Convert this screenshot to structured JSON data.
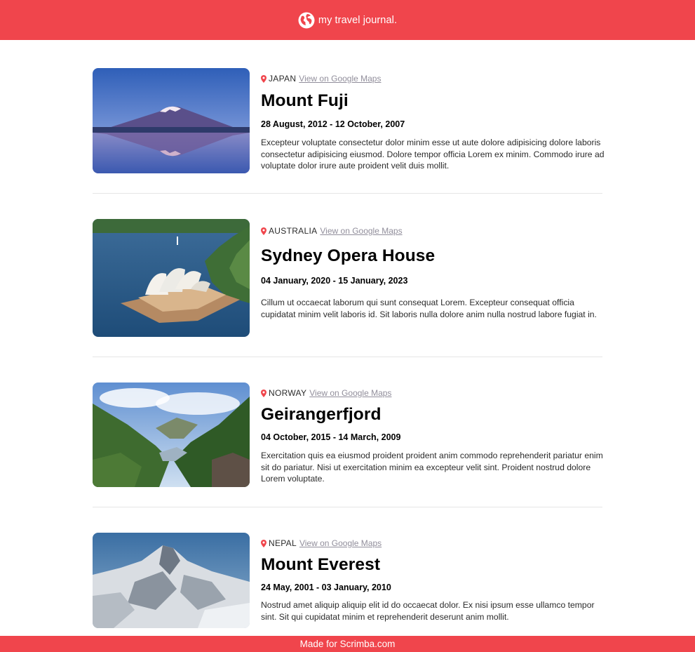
{
  "header": {
    "icon": "globe-icon",
    "title": "my travel journal."
  },
  "entries": [
    {
      "country": "Japan",
      "maps_label": "View on Google Maps",
      "title": "Mount Fuji",
      "dates": "28 August, 2012 - 12 October, 2007",
      "description": "Excepteur voluptate consectetur dolor minim esse ut aute dolore adipisicing dolore laboris consectetur adipisicing eiusmod. Dolore tempor officia Lorem ex minim. Commodo irure ad voluptate dolor irure aute proident velit duis mollit.",
      "image": "mount-fuji-photo"
    },
    {
      "country": "Australia",
      "maps_label": "View on Google Maps",
      "title": "Sydney Opera House",
      "dates": "04 January, 2020 - 15 January, 2023",
      "description": "Cillum ut occaecat laborum qui sunt consequat Lorem. Excepteur consequat officia cupidatat minim velit laboris id. Sit laboris nulla dolore anim nulla nostrud labore fugiat in.",
      "image": "sydney-opera-house-photo"
    },
    {
      "country": "Norway",
      "maps_label": "View on Google Maps",
      "title": "Geirangerfjord",
      "dates": "04 October, 2015 - 14 March, 2009",
      "description": "Exercitation quis ea eiusmod proident proident anim commodo reprehenderit pariatur enim sit do pariatur. Nisi ut exercitation minim ea excepteur velit sint. Proident nostrud dolore Lorem voluptate.",
      "image": "geirangerfjord-photo"
    },
    {
      "country": "Nepal",
      "maps_label": "View on Google Maps",
      "title": "Mount Everest",
      "dates": "24 May, 2001 - 03 January, 2010",
      "description": "Nostrud amet aliquip aliquip elit id do occaecat dolor. Ex nisi ipsum esse ullamco tempor sint. Sit qui cupidatat minim et reprehenderit deserunt anim mollit.",
      "image": "mount-everest-photo"
    }
  ],
  "footer": {
    "text": "Made for Scrimba.com"
  },
  "colors": {
    "brand": "#F0454C",
    "link": "#918E9B",
    "divider": "#E5E5E5"
  }
}
